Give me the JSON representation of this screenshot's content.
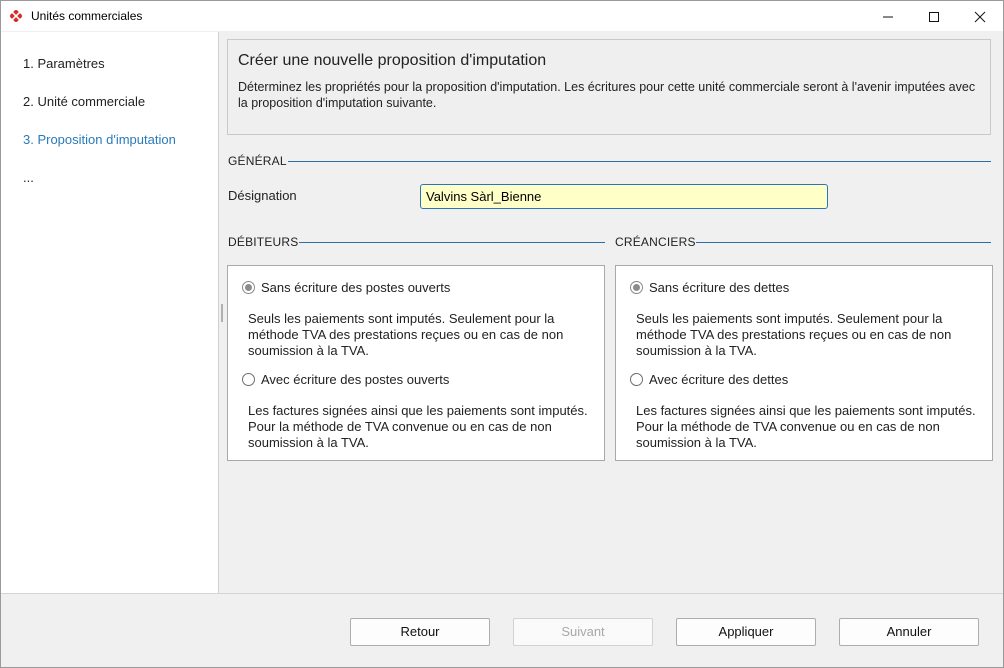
{
  "window": {
    "title": "Unités commerciales",
    "brand_color": "#d32f2f"
  },
  "sidebar": {
    "steps": [
      {
        "label": "1. Paramètres"
      },
      {
        "label": "2. Unité commerciale"
      },
      {
        "label": "3. Proposition d'imputation",
        "active": true
      },
      {
        "label": "..."
      }
    ]
  },
  "header": {
    "title": "Créer une nouvelle proposition d'imputation",
    "description": "Déterminez les propriétés pour la proposition d'imputation. Les écritures pour cette unité commerciale seront à l'avenir imputées avec la proposition d'imputation suivante."
  },
  "general": {
    "section_label": "GÉNÉRAL",
    "designation_label": "Désignation",
    "designation_value": "Valvins Sàrl_Bienne"
  },
  "debiteurs": {
    "section_label": "DÉBITEURS",
    "option1_label": "Sans écriture des postes ouverts",
    "option1_desc": "Seuls les paiements sont imputés. Seulement pour la méthode TVA des prestations reçues ou en cas de non soumission à la TVA.",
    "option2_label": "Avec écriture des postes ouverts",
    "option2_desc": "Les factures signées ainsi que les paiements sont imputés. Pour la méthode de TVA convenue ou en cas de non soumission à la TVA.",
    "selected": 1
  },
  "creanciers": {
    "section_label": "CRÉANCIERS",
    "option1_label": "Sans écriture des dettes",
    "option1_desc": "Seuls les paiements sont imputés. Seulement pour la méthode TVA des prestations reçues ou en cas de non soumission à la TVA.",
    "option2_label": "Avec écriture des dettes",
    "option2_desc": "Les factures signées ainsi que les paiements sont imputés. Pour la méthode de TVA convenue ou en cas de non soumission à la TVA.",
    "selected": 1
  },
  "buttons": {
    "back": "Retour",
    "next": "Suivant",
    "apply": "Appliquer",
    "cancel": "Annuler"
  },
  "colors": {
    "accent": "#2a7ab8",
    "input_bg": "#ffffc8"
  }
}
